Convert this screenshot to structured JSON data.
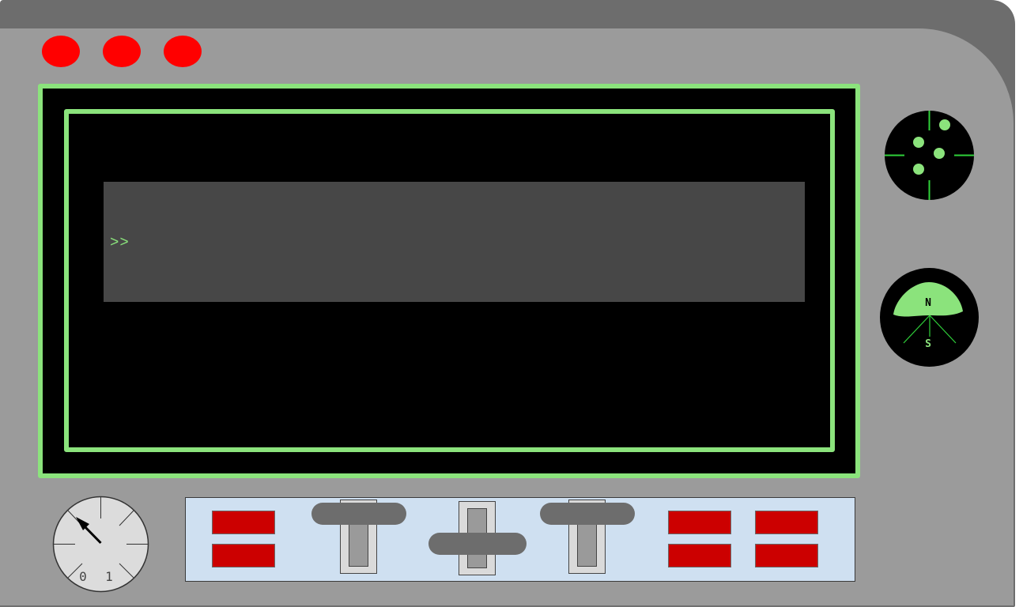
{
  "console": {
    "prompt": ">>",
    "input_value": "",
    "text_color": "#8be37c",
    "background_color": "#474747"
  },
  "status_lights": [
    {
      "name": "light-1",
      "color": "#ff0000"
    },
    {
      "name": "light-2",
      "color": "#ff0000"
    },
    {
      "name": "light-3",
      "color": "#ff0000"
    }
  ],
  "compass": {
    "north_label": "N",
    "south_label": "S"
  },
  "gauge": {
    "label_left": "0",
    "label_right": "1"
  },
  "controls": {
    "left_buttons": 2,
    "right_buttons": 4,
    "sliders": 3
  },
  "colors": {
    "accent_green": "#8be37c",
    "alert_red": "#cc0000",
    "panel_gray": "#9b9b9b",
    "control_panel_blue": "#cfe0f1"
  },
  "icons": {
    "radar": "radar-icon",
    "compass": "compass-icon",
    "gauge": "gauge-icon"
  }
}
